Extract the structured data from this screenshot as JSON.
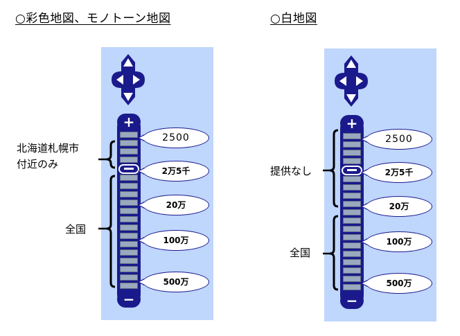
{
  "left": {
    "heading": "○彩色地図、モノトーン地図",
    "brace_upper_label": "北海道札幌市",
    "brace_upper_label_2": "付近のみ",
    "brace_lower_label": "全国",
    "zoom_in": "+",
    "zoom_out": "−",
    "scales": [
      "2500",
      "2万5千",
      "20万",
      "100万",
      "500万"
    ]
  },
  "right": {
    "heading": "○白地図",
    "brace_upper_label": "提供なし",
    "brace_lower_label": "全国",
    "zoom_in": "+",
    "zoom_out": "−",
    "scales": [
      "2500",
      "2万5千",
      "20万",
      "100万",
      "500万"
    ]
  },
  "colors": {
    "panel_bg": "#bfd6fd",
    "control_navy": "#1a1a8c",
    "segment_gray": "#9aa9be"
  },
  "icons": [
    "pan-arrows-icon",
    "plus-icon",
    "minus-icon"
  ]
}
